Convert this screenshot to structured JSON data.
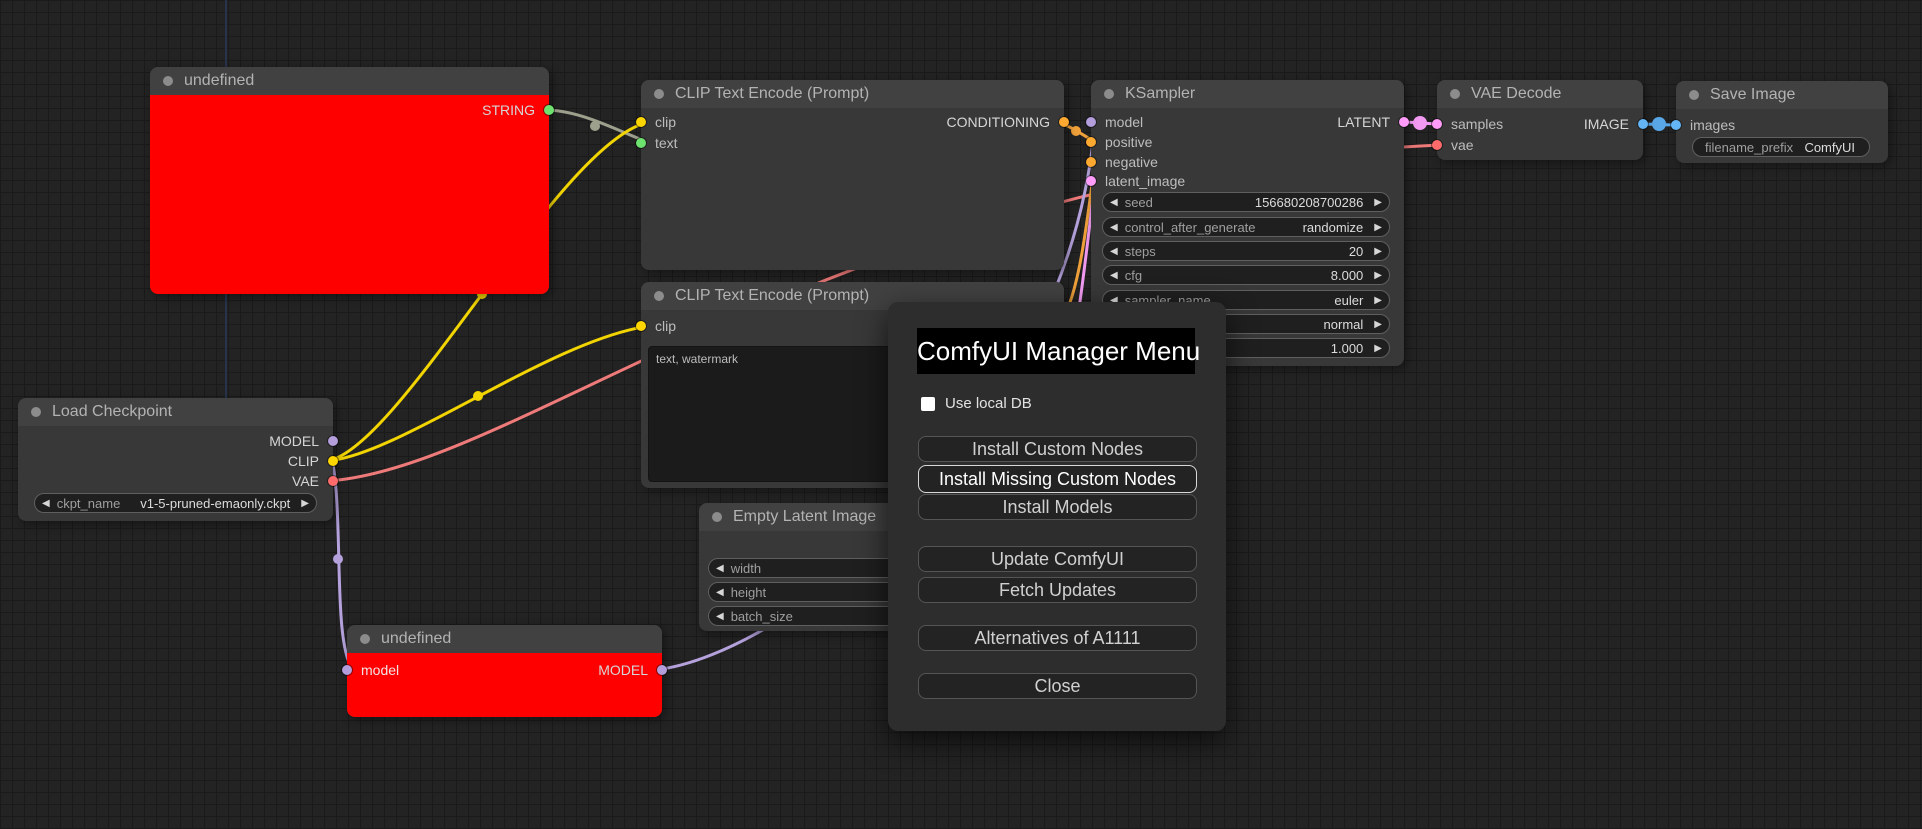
{
  "nodes": {
    "undefined1": {
      "title": "undefined",
      "outputs": [
        {
          "label": "STRING"
        }
      ]
    },
    "clipEncode1": {
      "title": "CLIP Text Encode (Prompt)",
      "inputs": [
        {
          "label": "clip"
        },
        {
          "label": "text"
        }
      ],
      "outputs": [
        {
          "label": "CONDITIONING"
        }
      ]
    },
    "clipEncode2": {
      "title": "CLIP Text Encode (Prompt)",
      "inputs": [
        {
          "label": "clip"
        }
      ],
      "prompt_text": "text, watermark"
    },
    "loadCheckpoint": {
      "title": "Load Checkpoint",
      "outputs": [
        {
          "label": "MODEL"
        },
        {
          "label": "CLIP"
        },
        {
          "label": "VAE"
        }
      ],
      "widgets": [
        {
          "label": "ckpt_name",
          "value": "v1-5-pruned-emaonly.ckpt"
        }
      ]
    },
    "ksampler": {
      "title": "KSampler",
      "inputs": [
        {
          "label": "model"
        },
        {
          "label": "positive"
        },
        {
          "label": "negative"
        },
        {
          "label": "latent_image"
        }
      ],
      "outputs": [
        {
          "label": "LATENT"
        }
      ],
      "widgets": [
        {
          "label": "seed",
          "value": "156680208700286"
        },
        {
          "label": "control_after_generate",
          "value": "randomize"
        },
        {
          "label": "steps",
          "value": "20"
        },
        {
          "label": "cfg",
          "value": "8.000"
        },
        {
          "label": "sampler_name",
          "value": "euler"
        },
        {
          "label": "",
          "value": "normal"
        },
        {
          "label": "",
          "value": "1.000"
        }
      ]
    },
    "emptyLatent": {
      "title": "Empty Latent Image",
      "widgets": [
        {
          "label": "width",
          "value": ""
        },
        {
          "label": "height",
          "value": ""
        },
        {
          "label": "batch_size",
          "value": ""
        }
      ]
    },
    "vaeDecode": {
      "title": "VAE Decode",
      "inputs": [
        {
          "label": "samples"
        },
        {
          "label": "vae"
        }
      ],
      "outputs": [
        {
          "label": "IMAGE"
        }
      ]
    },
    "saveImage": {
      "title": "Save Image",
      "inputs": [
        {
          "label": "images"
        }
      ],
      "widgets": [
        {
          "label": "filename_prefix",
          "value": "ComfyUI"
        }
      ]
    },
    "undefined2": {
      "title": "undefined",
      "inputs": [
        {
          "label": "model"
        }
      ],
      "outputs": [
        {
          "label": "MODEL"
        }
      ]
    }
  },
  "dialog": {
    "title": "ComfyUI Manager Menu",
    "checkbox": {
      "label": "Use local DB",
      "checked": false
    },
    "buttons": [
      {
        "label": "Install Custom Nodes"
      },
      {
        "label": "Install Missing Custom Nodes",
        "highlighted": true
      },
      {
        "label": "Install Models"
      },
      {
        "label": "Update ComfyUI"
      },
      {
        "label": "Fetch Updates"
      },
      {
        "label": "Alternatives of A1111"
      },
      {
        "label": "Close"
      }
    ]
  },
  "colors": {
    "node_error_body": "#ff0000",
    "slot_model": "#b39ddb",
    "slot_clip": "#ffd500",
    "slot_vae": "#ff6b6b",
    "slot_conditioning": "#ffa931",
    "slot_latent": "#ff9cf9",
    "slot_image": "#64b5f6",
    "slot_string_text": "#6ee26e",
    "wire_string": "#9ea08e",
    "wire_clip": "#f2d400",
    "wire_vae": "#ef7a7a",
    "wire_model": "#b5a2dd",
    "wire_conditioning": "#efa03a",
    "wire_latent": "#f29af2",
    "wire_image": "#5aa7e8"
  }
}
